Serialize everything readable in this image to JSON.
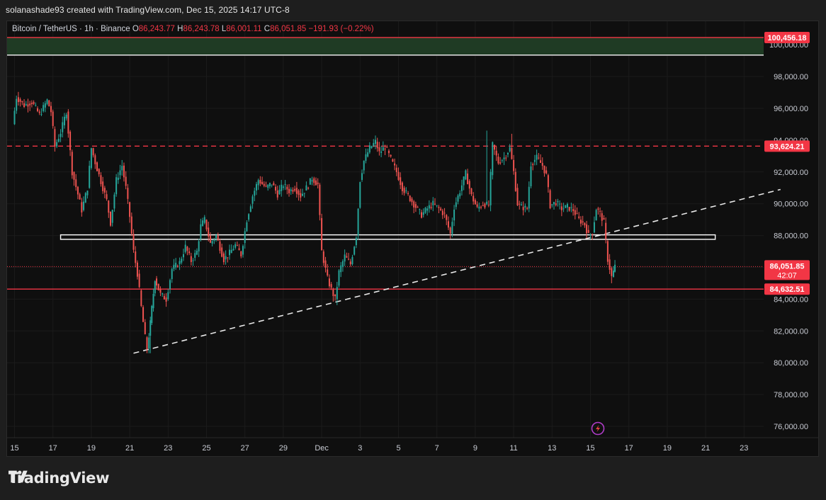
{
  "header": {
    "text": "solanashade93 created with TradingView.com, Dec 15, 2025 14:17 UTC-8"
  },
  "legend": {
    "symbol": "Bitcoin / TetherUS · 1h · Binance",
    "o_label": "O",
    "o_value": "86,243.77",
    "h_label": "H",
    "h_value": "86,243.78",
    "l_label": "L",
    "l_value": "86,001.11",
    "c_label": "C",
    "c_value": "86,051.85",
    "change": "−191.93 (−0.22%)"
  },
  "footer": {
    "brand": "TradingView"
  },
  "colors": {
    "up": "#26a69a",
    "down": "#ef5350",
    "accent_red": "#f23645",
    "zone": "#1f3b24"
  },
  "chart_data": {
    "type": "candlestick",
    "symbol": "Bitcoin / TetherUS",
    "interval": "1h",
    "exchange": "Binance",
    "ylim": [
      75000,
      101600
    ],
    "y_ticks": [
      76000,
      78000,
      80000,
      82000,
      84000,
      86000,
      88000,
      90000,
      92000,
      94000,
      96000,
      98000,
      100000
    ],
    "y_tick_labels": [
      "76,000.00",
      "78,000.00",
      "80,000.00",
      "82,000.00",
      "84,000.00",
      "86,000.00",
      "88,000.00",
      "90,000.00",
      "92,000.00",
      "94,000.00",
      "96,000.00",
      "98,000.00",
      "100,000.00"
    ],
    "x_ticks": [
      {
        "label": "15",
        "day": 0
      },
      {
        "label": "17",
        "day": 2
      },
      {
        "label": "19",
        "day": 4
      },
      {
        "label": "21",
        "day": 6
      },
      {
        "label": "23",
        "day": 8
      },
      {
        "label": "25",
        "day": 10
      },
      {
        "label": "27",
        "day": 12
      },
      {
        "label": "29",
        "day": 14
      },
      {
        "label": "Dec",
        "day": 16
      },
      {
        "label": "3",
        "day": 18
      },
      {
        "label": "5",
        "day": 20
      },
      {
        "label": "7",
        "day": 22
      },
      {
        "label": "9",
        "day": 24
      },
      {
        "label": "11",
        "day": 26
      },
      {
        "label": "13",
        "day": 28
      },
      {
        "label": "15",
        "day": 30
      },
      {
        "label": "17",
        "day": 32
      },
      {
        "label": "19",
        "day": 34
      },
      {
        "label": "21",
        "day": 36
      },
      {
        "label": "23",
        "day": 38
      }
    ],
    "price_path": [
      [
        0,
        95000
      ],
      [
        0.2,
        96700
      ],
      [
        0.6,
        96200
      ],
      [
        1.0,
        96400
      ],
      [
        1.4,
        95600
      ],
      [
        1.8,
        96500
      ],
      [
        2.0,
        95800
      ],
      [
        2.2,
        93600
      ],
      [
        2.5,
        94500
      ],
      [
        2.8,
        95800
      ],
      [
        3.1,
        92000
      ],
      [
        3.4,
        90600
      ],
      [
        3.6,
        89600
      ],
      [
        3.9,
        91000
      ],
      [
        4.1,
        93500
      ],
      [
        4.3,
        92600
      ],
      [
        4.6,
        91400
      ],
      [
        4.9,
        90200
      ],
      [
        5.1,
        88800
      ],
      [
        5.4,
        91500
      ],
      [
        5.7,
        92400
      ],
      [
        5.9,
        91000
      ],
      [
        6.1,
        89200
      ],
      [
        6.3,
        87000
      ],
      [
        6.5,
        85600
      ],
      [
        6.7,
        83500
      ],
      [
        6.9,
        81600
      ],
      [
        7.0,
        80900
      ],
      [
        7.15,
        82500
      ],
      [
        7.4,
        85300
      ],
      [
        7.7,
        84300
      ],
      [
        8.0,
        84000
      ],
      [
        8.3,
        85900
      ],
      [
        8.7,
        86300
      ],
      [
        9.0,
        87300
      ],
      [
        9.3,
        86400
      ],
      [
        9.6,
        87000
      ],
      [
        9.8,
        88600
      ],
      [
        10.0,
        89000
      ],
      [
        10.3,
        87500
      ],
      [
        10.6,
        88000
      ],
      [
        11.0,
        86500
      ],
      [
        11.3,
        86900
      ],
      [
        11.6,
        87400
      ],
      [
        11.9,
        86800
      ],
      [
        12.2,
        89000
      ],
      [
        12.5,
        90500
      ],
      [
        12.8,
        91500
      ],
      [
        13.2,
        91000
      ],
      [
        13.5,
        91300
      ],
      [
        13.8,
        90600
      ],
      [
        14.1,
        91200
      ],
      [
        14.4,
        90800
      ],
      [
        14.7,
        91000
      ],
      [
        15.0,
        90500
      ],
      [
        15.3,
        91000
      ],
      [
        15.6,
        91600
      ],
      [
        15.9,
        91200
      ],
      [
        16.1,
        87000
      ],
      [
        16.4,
        85300
      ],
      [
        16.6,
        84600
      ],
      [
        16.8,
        84000
      ],
      [
        17.0,
        85700
      ],
      [
        17.3,
        86700
      ],
      [
        17.6,
        86200
      ],
      [
        17.9,
        88000
      ],
      [
        18.1,
        91500
      ],
      [
        18.3,
        92700
      ],
      [
        18.6,
        93500
      ],
      [
        18.9,
        93900
      ],
      [
        19.1,
        93200
      ],
      [
        19.4,
        93600
      ],
      [
        19.7,
        92800
      ],
      [
        20.0,
        92000
      ],
      [
        20.3,
        91000
      ],
      [
        20.6,
        90500
      ],
      [
        21.0,
        89800
      ],
      [
        21.3,
        89300
      ],
      [
        21.6,
        89700
      ],
      [
        21.9,
        90000
      ],
      [
        22.2,
        89700
      ],
      [
        22.5,
        89300
      ],
      [
        22.8,
        88100
      ],
      [
        23.0,
        89800
      ],
      [
        23.3,
        90800
      ],
      [
        23.6,
        91900
      ],
      [
        23.9,
        90500
      ],
      [
        24.2,
        89700
      ],
      [
        24.5,
        90000
      ],
      [
        24.8,
        89900
      ],
      [
        25.0,
        93700
      ],
      [
        25.3,
        92600
      ],
      [
        25.6,
        92900
      ],
      [
        25.9,
        93500
      ],
      [
        26.1,
        92000
      ],
      [
        26.3,
        90000
      ],
      [
        26.5,
        89800
      ],
      [
        26.8,
        89700
      ],
      [
        27.0,
        92500
      ],
      [
        27.3,
        92900
      ],
      [
        27.6,
        92400
      ],
      [
        27.8,
        91800
      ],
      [
        28.0,
        89900
      ],
      [
        28.3,
        90100
      ],
      [
        28.6,
        89700
      ],
      [
        28.9,
        89800
      ],
      [
        29.2,
        89600
      ],
      [
        29.5,
        89000
      ],
      [
        29.8,
        88700
      ],
      [
        30.0,
        88000
      ],
      [
        30.2,
        88200
      ],
      [
        30.4,
        89700
      ],
      [
        30.6,
        89400
      ],
      [
        30.8,
        88800
      ],
      [
        31.0,
        86500
      ],
      [
        31.2,
        85400
      ],
      [
        31.35,
        86050
      ]
    ],
    "wick_extremes": [
      {
        "day": 7.05,
        "low": 80600
      },
      {
        "day": 0.1,
        "high": 96800
      },
      {
        "day": 24.6,
        "high": 94600
      },
      {
        "day": 25.9,
        "high": 94400
      },
      {
        "day": 16.7,
        "low": 83900
      },
      {
        "day": 31.1,
        "low": 85000
      }
    ],
    "horizontal_levels": [
      {
        "value": 100456.18,
        "label": "100,456.18",
        "style": "solid",
        "color": "#f23645"
      },
      {
        "value": 93624.21,
        "label": "93,624.21",
        "style": "dashed",
        "color": "#f23645"
      },
      {
        "value": 86051.85,
        "label": "86,051.85",
        "style": "dotted",
        "color": "#f23645",
        "countdown": "42:07"
      },
      {
        "value": 84632.51,
        "label": "84,632.51",
        "style": "solid",
        "color": "#f23645"
      }
    ],
    "zone": {
      "top": 100456.18,
      "bottom": 99350,
      "color": "#1f3b24"
    },
    "support_band": {
      "top": 88000,
      "bottom": 87850,
      "start_day": 2.4,
      "end_day": 36.5,
      "color": "#ffffff"
    },
    "trendline": {
      "start": [
        6.2,
        80600
      ],
      "end": [
        39.9,
        90900
      ],
      "style": "dashed",
      "color": "#e8e8e8"
    },
    "grid": true
  }
}
